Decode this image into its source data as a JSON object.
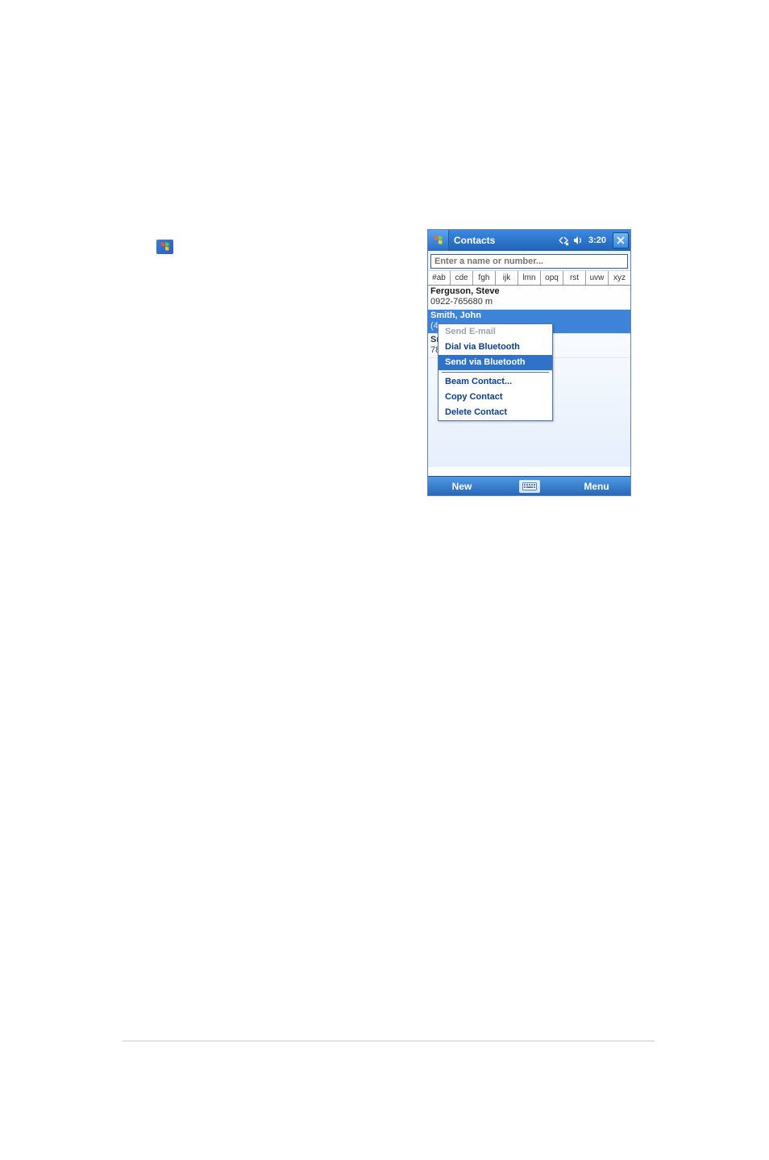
{
  "titlebar": {
    "title": "Contacts",
    "time": "3:20",
    "conn_icon": "conn-icon",
    "sound_icon": "sound-icon",
    "close_icon": "close-icon"
  },
  "search": {
    "placeholder": "Enter a name or number..."
  },
  "alphabar": [
    "#ab",
    "cde",
    "fgh",
    "ijk",
    "lmn",
    "opq",
    "rst",
    "uvw",
    "xyz"
  ],
  "contacts": [
    {
      "name": "Ferguson, Steve",
      "sub": "0922-765680   m",
      "state": "normal"
    },
    {
      "name": "Smith, John",
      "sub": "(4",
      "state": "selected"
    },
    {
      "name": "Sn",
      "sub": "78",
      "state": "dim"
    }
  ],
  "context_menu": {
    "items": [
      {
        "label": "Send E-mail",
        "disabled": true
      },
      {
        "label": "Dial via Bluetooth",
        "disabled": false
      },
      {
        "label": "Send via Bluetooth",
        "disabled": false,
        "selected": true
      },
      {
        "sep": true
      },
      {
        "label": "Beam Contact...",
        "disabled": false
      },
      {
        "label": "Copy Contact",
        "disabled": false
      },
      {
        "label": "Delete Contact",
        "disabled": false
      }
    ]
  },
  "bottombar": {
    "new_label": "New",
    "menu_label": "Menu",
    "keyboard_icon": "keyboard-icon"
  },
  "colors": {
    "accent": "#2f73c9",
    "titlebar_top": "#3b8ae0",
    "titlebar_bottom": "#1f63b6"
  }
}
